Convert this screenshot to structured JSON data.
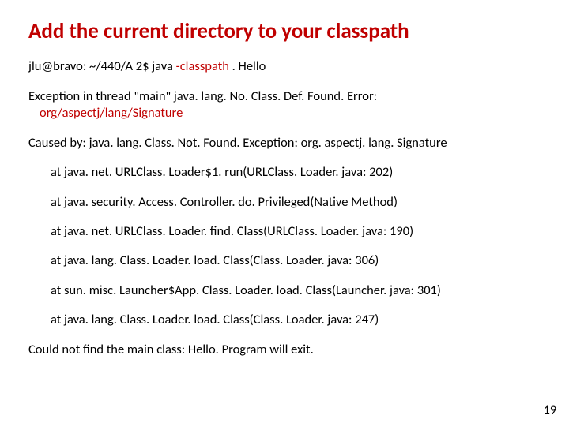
{
  "title": "Add the current directory to your classpath",
  "cmd": {
    "prompt": "jlu@bravo: ~/440/A 2$ java ",
    "flag": "-classpath ",
    "rest": ". Hello"
  },
  "exc": {
    "head": "Exception in thread \"main\" java. lang. No. Class. Def. Found. Error:",
    "sig": "org/aspectj/lang/Signature"
  },
  "caused": "Caused by: java. lang. Class. Not. Found. Exception: org. aspectj. lang. Signature",
  "trace": [
    "at java. net. URLClass. Loader$1. run(URLClass. Loader. java: 202)",
    "at java. security. Access. Controller. do. Privileged(Native Method)",
    "at java. net. URLClass. Loader. find. Class(URLClass. Loader. java: 190)",
    "at java. lang. Class. Loader. load. Class(Class. Loader. java: 306)",
    "at sun. misc. Launcher$App. Class. Loader. load. Class(Launcher. java: 301)",
    "at java. lang. Class. Loader. load. Class(Class. Loader. java: 247)"
  ],
  "footer": "Could not find the main class: Hello.  Program will exit.",
  "page": "19"
}
